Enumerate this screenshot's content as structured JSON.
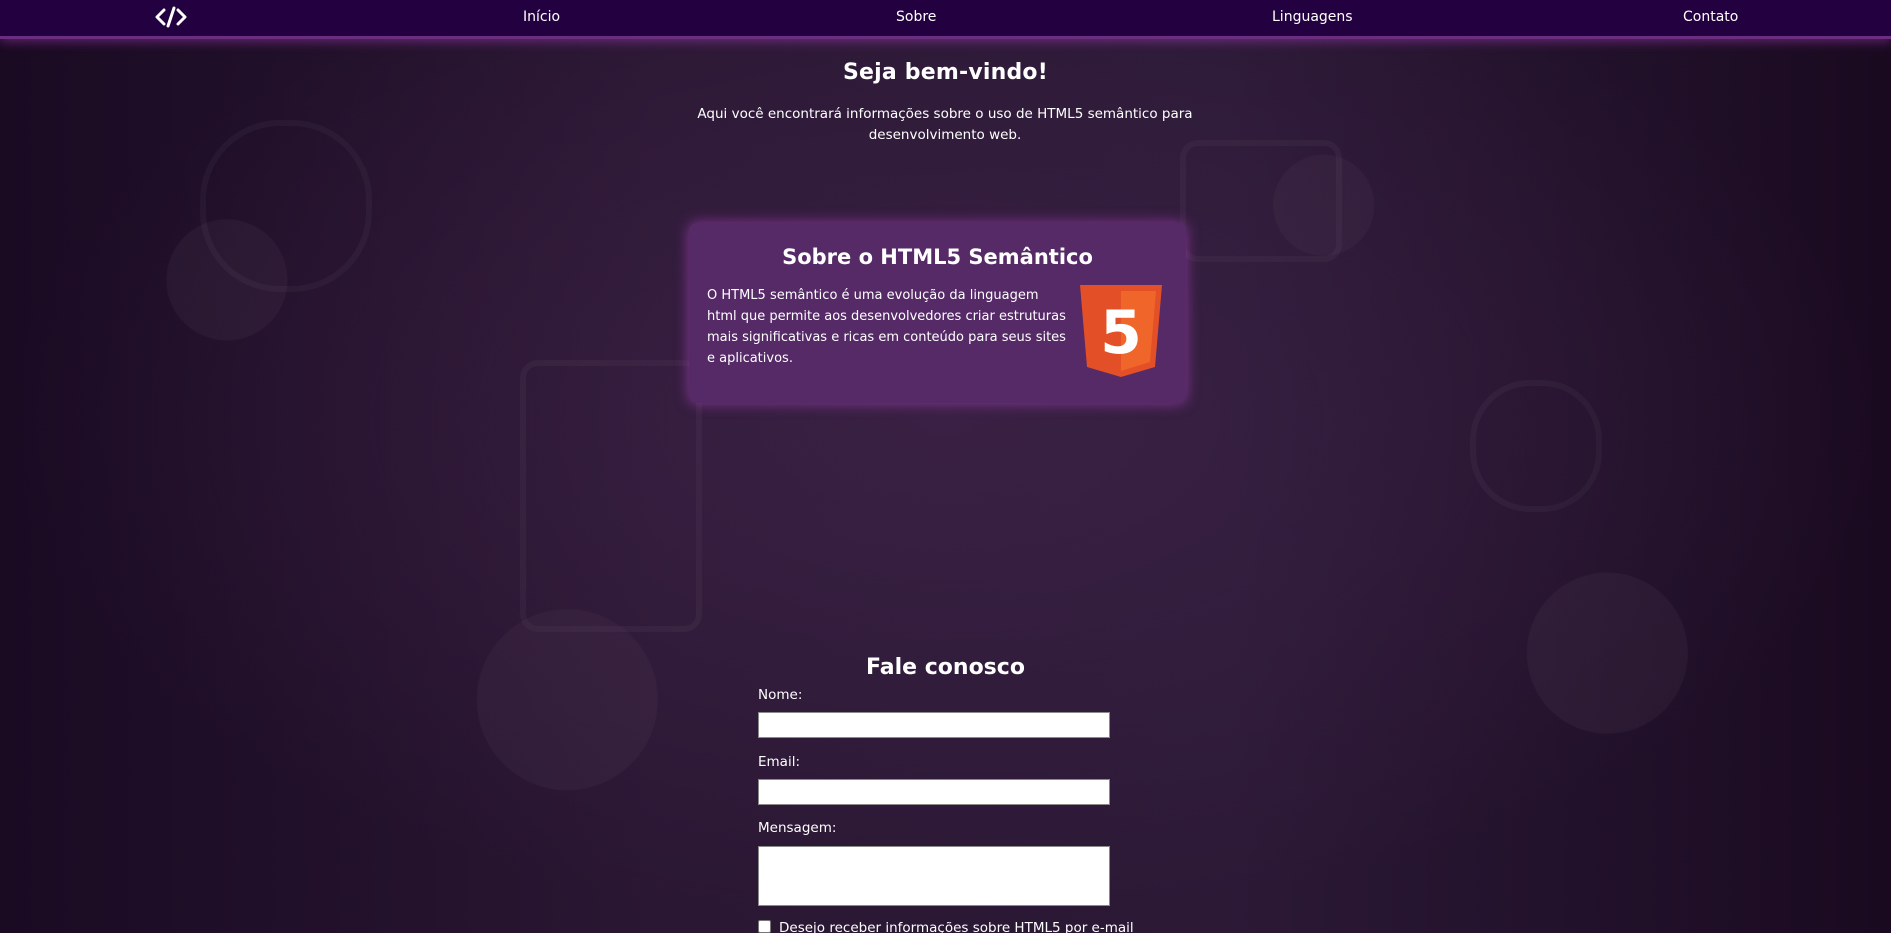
{
  "nav": {
    "logo_icon": "code-icon",
    "items": [
      "Início",
      "Sobre",
      "Linguagens",
      "Contato"
    ]
  },
  "hero": {
    "title": "Seja bem-vindo!",
    "text": "Aqui você encontrará informações sobre o uso de HTML5 semântico para desenvolvimento web."
  },
  "about": {
    "title": "Sobre o HTML5 Semântico",
    "text": "O HTML5 semântico é uma evolução da linguagem html que permite aos desenvolvedores criar estruturas mais significativas e ricas em conteúdo para seus sites e aplicativos.",
    "logo_icon": "html5-logo",
    "logo_number": "5"
  },
  "contact": {
    "title": "Fale conosco",
    "name_label": "Nome:",
    "name_value": "",
    "email_label": "Email:",
    "email_value": "",
    "message_label": "Mensagem:",
    "message_value": "",
    "newsletter_label": "Desejo receber informações sobre HTML5 por e-mail"
  },
  "colors": {
    "nav_bg": "#23003f",
    "card_bg": "#552a67",
    "glow": "#b446c8",
    "html5_orange": "#e34f26",
    "html5_light": "#f06529"
  }
}
